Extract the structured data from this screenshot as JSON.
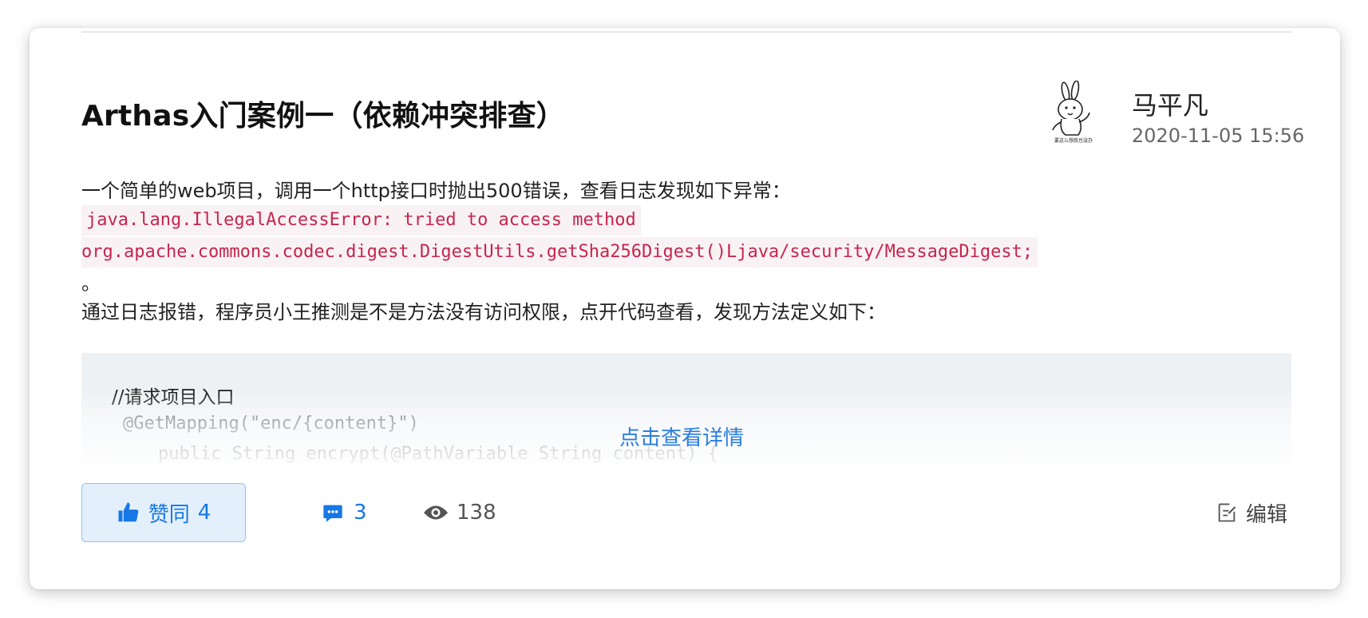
{
  "post": {
    "title": "Arthas入门案例一（依赖冲突排查）",
    "author": {
      "name": "马平凡",
      "timestamp": "2020-11-05 15:56",
      "avatar_caption": "要这么想我也没办"
    },
    "body": {
      "paragraph1": "一个简单的web项目，调用一个http接口时抛出500错误，查看日志发现如下异常：",
      "exception_line1": "java.lang.IllegalAccessError: tried to access method",
      "exception_line2": "org.apache.commons.codec.digest.DigestUtils.getSha256Digest()Ljava/security/MessageDigest;",
      "period": "。",
      "paragraph2": "通过日志报错，程序员小王推测是不是方法没有访问权限，点开代码查看，发现方法定义如下："
    },
    "code_preview": {
      "line1": "//请求项目入口",
      "line2": "@GetMapping(\"enc/{content}\")",
      "line3": "public String encrypt(@PathVariable String content) {"
    },
    "see_details_label": "点击查看详情"
  },
  "actions": {
    "like_label": "赞同",
    "like_count": "4",
    "comment_count": "3",
    "view_count": "138",
    "edit_label": "编辑"
  },
  "colors": {
    "accent": "#1677e6",
    "like_bg": "#e3f0fc",
    "inline_code_text": "#c7254e",
    "inline_code_bg": "#f9f2f4",
    "code_block_bg": "#eef1f4"
  },
  "icons": {
    "like": "thumbs-up-icon",
    "comment": "comment-icon",
    "views": "eye-icon",
    "edit": "edit-icon"
  }
}
